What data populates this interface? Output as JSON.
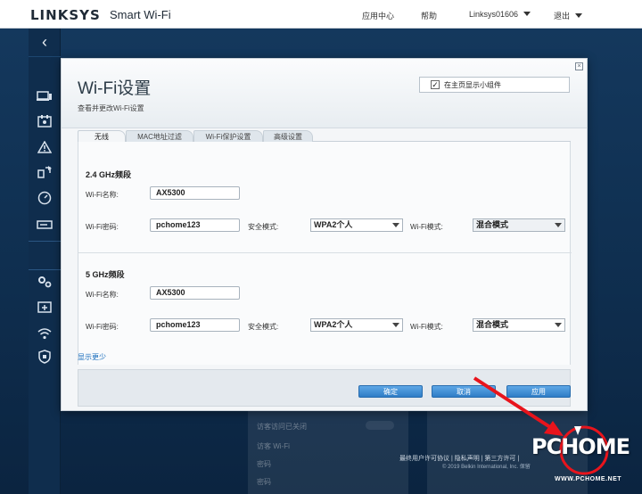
{
  "topbar": {
    "brand": "LINKSYS",
    "product": "Smart Wi-Fi",
    "nav": {
      "app_center": "应用中心",
      "help": "帮助",
      "account": "Linksys01606",
      "logout": "退出"
    }
  },
  "sidebar": {
    "icons": [
      "devices-icon",
      "parental-controls-icon",
      "alert-icon",
      "media-priority-icon",
      "speed-test-icon",
      "external-storage-icon",
      "settings-icon",
      "troubleshooting-icon",
      "wifi-settings-icon",
      "security-icon"
    ]
  },
  "modal": {
    "close": "×",
    "title": "Wi-Fi设置",
    "subtitle": "查看并更改Wi-Fi设置",
    "show_widget_checked": true,
    "show_widget_label": "在主页显示小组件",
    "tabs": [
      {
        "label": "无线",
        "active": true
      },
      {
        "label": "MAC地址过滤",
        "active": false
      },
      {
        "label": "Wi-Fi保护设置",
        "active": false
      },
      {
        "label": "高级设置",
        "active": false
      }
    ],
    "bands": [
      {
        "title": "2.4 GHz频段",
        "name_label": "Wi-Fi名称:",
        "name_value": "AX5300",
        "password_label": "Wi-Fi密码:",
        "password_value": "pchome123",
        "security_label": "安全模式:",
        "security_value": "WPA2个人",
        "mode_label": "Wi-Fi模式:",
        "mode_value": "混合模式"
      },
      {
        "title": "5 GHz频段",
        "name_label": "Wi-Fi名称:",
        "name_value": "AX5300",
        "password_label": "Wi-Fi密码:",
        "password_value": "pchome123",
        "security_label": "安全模式:",
        "security_value": "WPA2个人",
        "mode_label": "Wi-Fi模式:",
        "mode_value": "混合模式"
      }
    ],
    "show_less": "显示更少",
    "buttons": {
      "ok": "确定",
      "cancel": "取消",
      "apply": "应用"
    }
  },
  "background": {
    "ghost_1": "访客访问已关闭",
    "ghost_2": "访客 Wi-Fi",
    "ghost_3": "密码",
    "ghost_4": "密码",
    "footer_links": "最终用户许可协议 | 隐私声明 | 第三方许可 |",
    "footer_copy": "© 2019 Belkin International, Inc. 保留"
  },
  "watermark": {
    "brand": "PCHOME",
    "url": "WWW.PCHOME.NET"
  },
  "colors": {
    "accent": "#2f7dc6",
    "background": "#0f2f50",
    "annotation": "#e8141c"
  }
}
